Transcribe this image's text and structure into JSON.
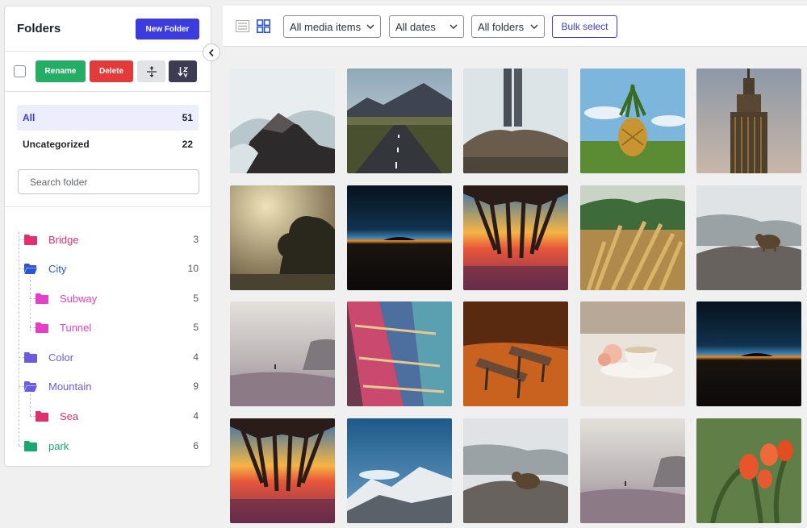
{
  "sidebar": {
    "title": "Folders",
    "new_folder_label": "New Folder",
    "tools": {
      "rename_label": "Rename",
      "delete_label": "Delete"
    },
    "categories": [
      {
        "label": "All",
        "count": "51"
      },
      {
        "label": "Uncategorized",
        "count": "22"
      }
    ],
    "search_placeholder": "Search folder",
    "folders": [
      {
        "name": "Bridge",
        "count": "3",
        "color": "#e0306f"
      },
      {
        "name": "City",
        "count": "10",
        "color": "#2a54d4"
      },
      {
        "name": "Subway",
        "count": "5",
        "color": "#e53ec8"
      },
      {
        "name": "Tunnel",
        "count": "5",
        "color": "#e53ec8"
      },
      {
        "name": "Color",
        "count": "4",
        "color": "#6a5ce0"
      },
      {
        "name": "Mountain",
        "count": "9",
        "color": "#6a5ce0"
      },
      {
        "name": "Sea",
        "count": "4",
        "color": "#e0306f"
      },
      {
        "name": "park",
        "count": "6",
        "color": "#1aa772"
      }
    ]
  },
  "toolbar": {
    "filter_media": "All media items",
    "filter_dates": "All dates",
    "filter_folders": "All folders",
    "bulk_select_label": "Bulk select"
  },
  "icons": [
    "check-box-icon",
    "move-icon",
    "sort-icon",
    "collapse-chevron-icon",
    "list-view-icon",
    "grid-view-icon",
    "folder-icon",
    "chevron-down-icon"
  ],
  "media": [
    "crashing-waves-rocks",
    "mountain-road",
    "person-legs-on-rock",
    "pineapple-field",
    "empire-state-building",
    "misty-tree-sunlight",
    "dark-horizon-sunset",
    "pier-sunset",
    "wheat-field",
    "bear-on-rocks",
    "misty-beach",
    "colorful-blanket",
    "bench-autumn-leaves",
    "teacup-flowers",
    "dark-horizon-sunset-2",
    "pier-sunset-2",
    "snowy-mountain",
    "bear-on-rocks-2",
    "misty-beach-2",
    "red-tulips"
  ],
  "colors": {
    "accent": "#3b3be0",
    "rename": "#25ad66",
    "delete": "#e33a3a"
  }
}
